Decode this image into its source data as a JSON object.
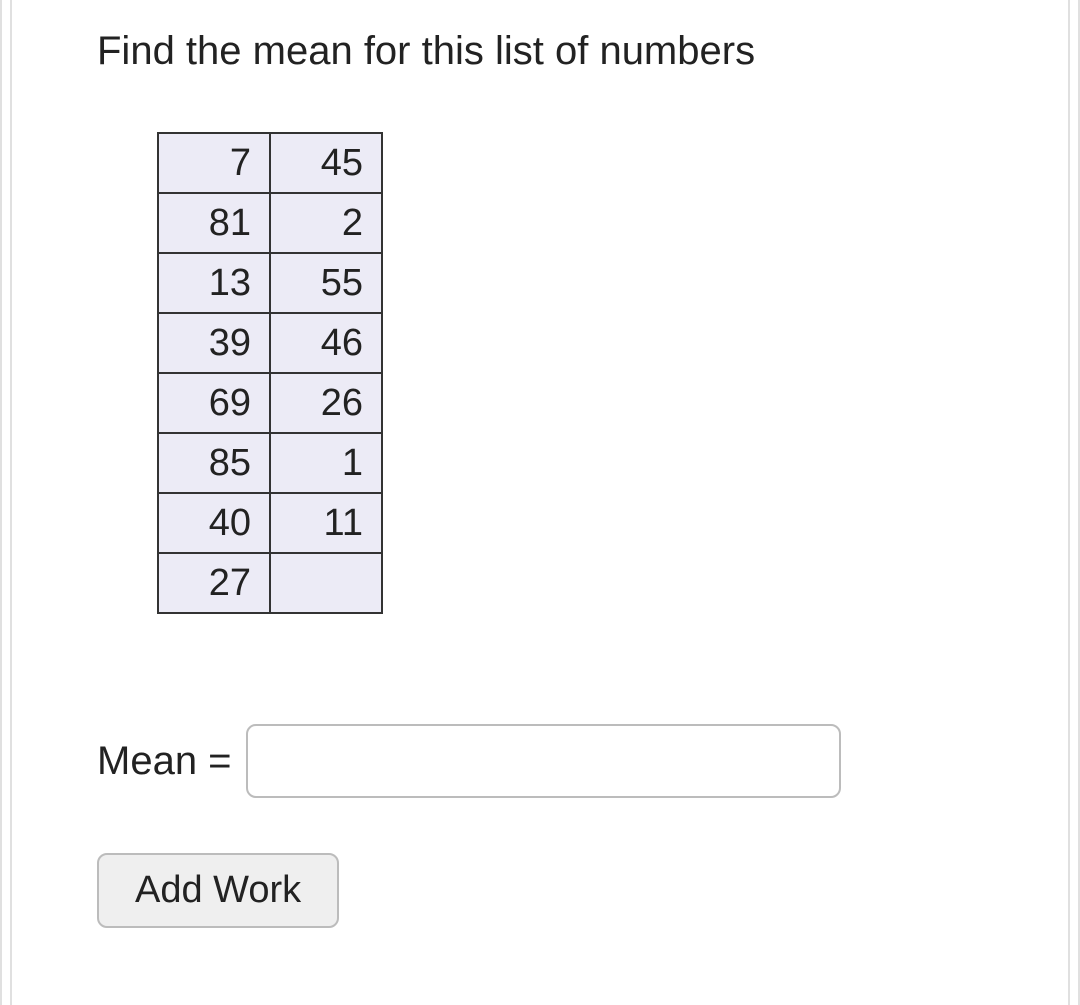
{
  "prompt": "Find the mean for this list of numbers",
  "table": {
    "rows": [
      [
        "7",
        "45"
      ],
      [
        "81",
        "2"
      ],
      [
        "13",
        "55"
      ],
      [
        "39",
        "46"
      ],
      [
        "69",
        "26"
      ],
      [
        "85",
        "1"
      ],
      [
        "40",
        "11"
      ],
      [
        "27",
        ""
      ]
    ]
  },
  "answer": {
    "label": "Mean =",
    "value": ""
  },
  "addWorkLabel": "Add Work"
}
